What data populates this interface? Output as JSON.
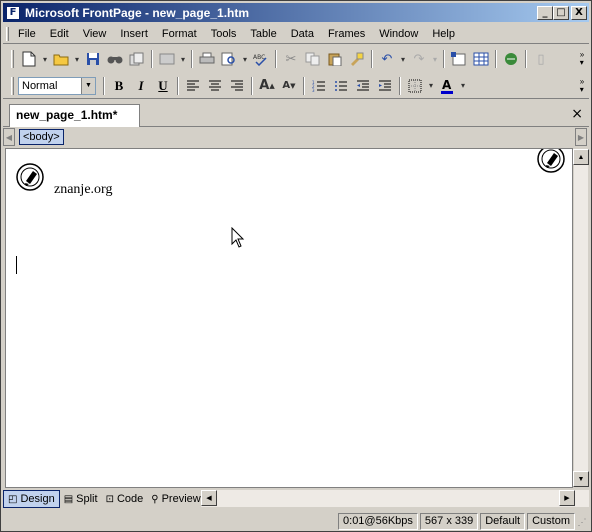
{
  "window": {
    "title": "Microsoft FrontPage - new_page_1.htm"
  },
  "title_buttons": {
    "minimize": "_",
    "maximize": "□",
    "close": "X"
  },
  "menu": [
    {
      "key": "F",
      "rest": "ile"
    },
    {
      "key": "E",
      "rest": "dit"
    },
    {
      "key": "V",
      "rest": "iew"
    },
    {
      "key": "I",
      "rest": "nsert"
    },
    {
      "key": "",
      "pre": "F",
      "rest": "ormat",
      "underline_index": 1
    },
    {
      "key": "T",
      "rest": "ools"
    },
    {
      "key": "",
      "pre": "T",
      "rest": "able",
      "underline_index": 1
    },
    {
      "key": "D",
      "rest": "ata"
    },
    {
      "key": "",
      "pre": "F",
      "rest": "rames",
      "underline_index": 2
    },
    {
      "key": "W",
      "rest": "indow"
    },
    {
      "key": "H",
      "rest": "elp"
    }
  ],
  "menu_labels": [
    "File",
    "Edit",
    "View",
    "Insert",
    "Format",
    "Tools",
    "Table",
    "Data",
    "Frames",
    "Window",
    "Help"
  ],
  "format_toolbar": {
    "style": "Normal",
    "bold": "B",
    "italic": "I",
    "underline": "U"
  },
  "document": {
    "tab_label": "new_page_1.htm*",
    "close_glyph": "×",
    "quick_tag": "<body>",
    "site_text": "znanje.org"
  },
  "view_tabs": [
    {
      "label": "Design",
      "icon": "design-icon"
    },
    {
      "label": "Split",
      "icon": "split-icon"
    },
    {
      "label": "Code",
      "icon": "code-icon"
    },
    {
      "label": "Preview",
      "icon": "preview-icon"
    }
  ],
  "status": {
    "download": "0:01@56Kbps",
    "size": "567 x 339",
    "style": "Default",
    "mode": "Custom"
  }
}
